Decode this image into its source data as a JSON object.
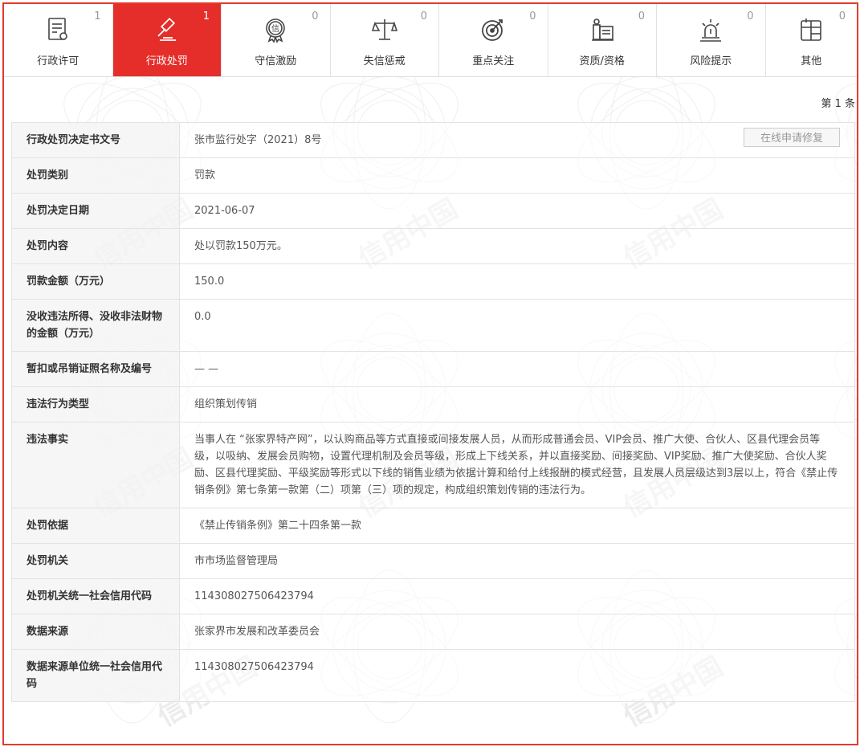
{
  "tabs": [
    {
      "label": "行政许可",
      "count": "1",
      "icon": "document-list-icon",
      "active": false
    },
    {
      "label": "行政处罚",
      "count": "1",
      "icon": "gavel-icon",
      "active": true
    },
    {
      "label": "守信激励",
      "count": "0",
      "icon": "trust-medal-icon",
      "active": false
    },
    {
      "label": "失信惩戒",
      "count": "0",
      "icon": "balance-scale-icon",
      "active": false
    },
    {
      "label": "重点关注",
      "count": "0",
      "icon": "target-icon",
      "active": false
    },
    {
      "label": "资质/资格",
      "count": "0",
      "icon": "certificate-icon",
      "active": false
    },
    {
      "label": "风险提示",
      "count": "0",
      "icon": "alarm-light-icon",
      "active": false
    },
    {
      "label": "其他",
      "count": "0",
      "icon": "grid-window-icon",
      "active": false
    }
  ],
  "pager": {
    "text": "第 1 条"
  },
  "repair_button": "在线申请修复",
  "watermark_text": "信用中国",
  "records": [
    {
      "key": "行政处罚决定书文号",
      "value": "张市监行处字（2021）8号"
    },
    {
      "key": "处罚类别",
      "value": "罚款"
    },
    {
      "key": "处罚决定日期",
      "value": "2021-06-07"
    },
    {
      "key": "处罚内容",
      "value": "处以罚款150万元。"
    },
    {
      "key": "罚款金额（万元）",
      "value": "150.0"
    },
    {
      "key": "没收违法所得、没收非法财物的金额（万元）",
      "value": "0.0"
    },
    {
      "key": "暂扣或吊销证照名称及编号",
      "value": "— —"
    },
    {
      "key": "违法行为类型",
      "value": "组织策划传销"
    },
    {
      "key": "违法事实",
      "value": "当事人在 “张家界特产网”，以认购商品等方式直接或间接发展人员，从而形成普通会员、VIP会员、推广大使、合伙人、区县代理会员等级，以吸纳、发展会员购物，设置代理机制及会员等级，形成上下线关系，并以直接奖励、间接奖励、VIP奖励、推广大使奖励、合伙人奖励、区县代理奖励、平级奖励等形式以下线的销售业绩为依据计算和给付上线报酬的模式经营，且发展人员层级达到3层以上，符合《禁止传销条例》第七条第一款第（二）项第（三）项的规定，构成组织策划传销的违法行为。"
    },
    {
      "key": "处罚依据",
      "value": "《禁止传销条例》第二十四条第一款"
    },
    {
      "key": "处罚机关",
      "value": "市市场监督管理局"
    },
    {
      "key": "处罚机关统一社会信用代码",
      "value": "114308027506423794"
    },
    {
      "key": "数据来源",
      "value": "张家界市发展和改革委员会"
    },
    {
      "key": "数据来源单位统一社会信用代码",
      "value": "114308027506423794"
    }
  ]
}
